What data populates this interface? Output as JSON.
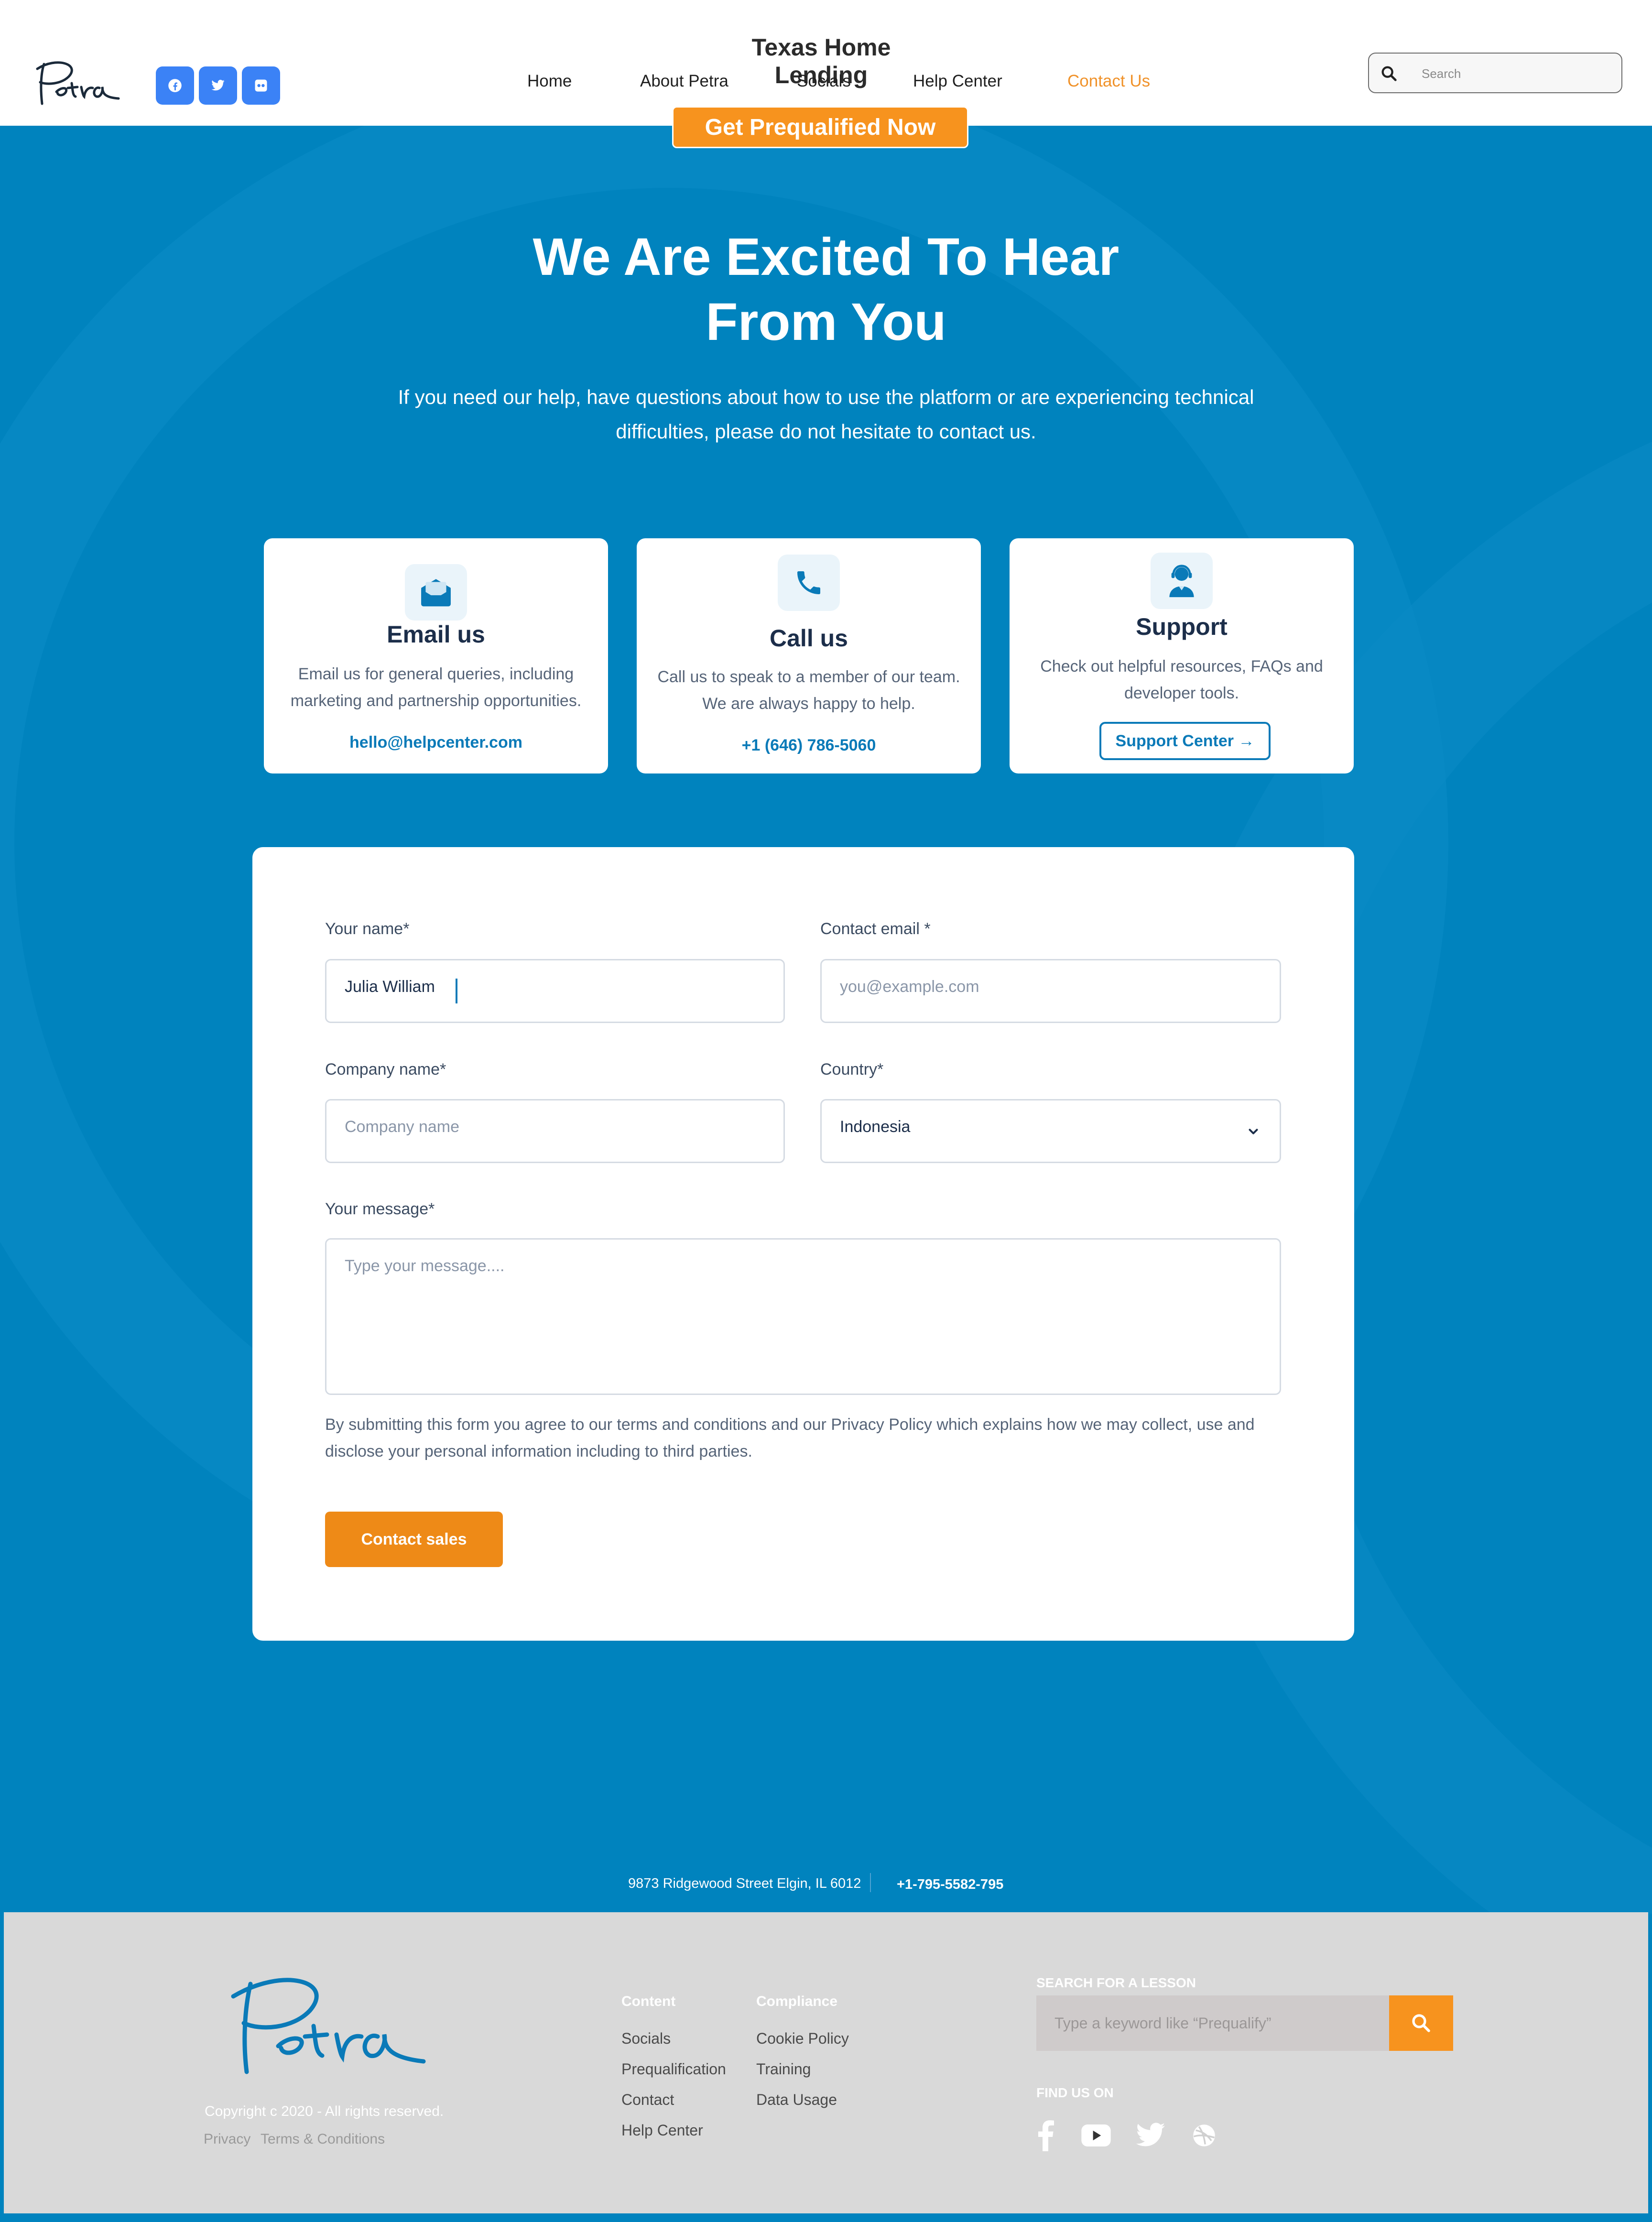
{
  "header": {
    "site_title": "Texas Home Lending",
    "nav": [
      {
        "label": "Home"
      },
      {
        "label": "About Petra"
      },
      {
        "label": "Socials"
      },
      {
        "label": "Help Center"
      },
      {
        "label": "Contact Us",
        "active": true
      }
    ],
    "search_placeholder": "Search",
    "social_icons": [
      "facebook-icon",
      "twitter-icon",
      "flickr-icon"
    ],
    "cta_label": "Get Prequalified Now"
  },
  "hero": {
    "title_line1": "We Are Excited To Hear",
    "title_line2": "From You",
    "subtitle_line1": "If you need our help, have questions about how to use the platform or are experiencing technical",
    "subtitle_line2": "difficulties, please do not hesitate to contact us."
  },
  "cards": {
    "email": {
      "title": "Email us",
      "desc_line1": "Email us for general queries, including",
      "desc_line2": "marketing and partnership opportunities.",
      "link": "hello@helpcenter.com"
    },
    "call": {
      "title": "Call us",
      "desc_line1": "Call us to speak to a member of our team.",
      "desc_line2": "We are always happy to help.",
      "link": "+1 (646) 786-5060"
    },
    "support": {
      "title": "Support",
      "desc_line1": "Check out helpful resources, FAQs and",
      "desc_line2": "developer tools.",
      "button": "Support Center →"
    }
  },
  "form": {
    "name_label": "Your name*",
    "name_value": "Julia William",
    "email_label": "Contact email *",
    "email_placeholder": "you@example.com",
    "company_label": "Company name*",
    "company_placeholder": "Company name",
    "country_label": "Country*",
    "country_value": "Indonesia",
    "message_label": "Your message*",
    "message_placeholder": "Type your message....",
    "consent_line1": "By submitting this form you agree to our terms and conditions and our Privacy Policy which explains how we may collect, use and",
    "consent_line2": "disclose your personal information including to third parties.",
    "submit": "Contact sales"
  },
  "contact_strip": {
    "address": "9873 Ridgewood Street Elgin, IL 6012",
    "phone": "+1-795-5582-795"
  },
  "footer": {
    "copyright": "Copyright c 2020 - All rights reserved.",
    "privacy": "Privacy",
    "terms": "Terms & Conditions",
    "content_heading": "Content",
    "content_links": [
      "Socials",
      "Prequalification",
      "Contact",
      "Help Center"
    ],
    "compliance_heading": "Compliance",
    "compliance_links": [
      "Cookie Policy",
      "Training",
      "Data Usage"
    ],
    "lesson_label": "SEARCH FOR A LESSON",
    "lesson_placeholder": "Type a keyword like “Prequalify”",
    "find_label": "FIND US ON",
    "social_icons": [
      "facebook-icon",
      "youtube-icon",
      "twitter-icon",
      "dribbble-icon"
    ]
  },
  "colors": {
    "primary_blue": "#0083be",
    "accent_orange": "#f7931e",
    "active_nav": "#f0922a",
    "footer_gray": "#d9d9d9"
  }
}
